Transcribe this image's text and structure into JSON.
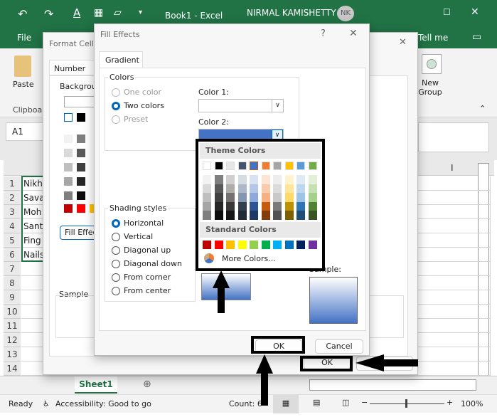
{
  "titlebar": {
    "doc_title": "Book1  -  Excel",
    "user_name": "NIRMAL KAMISHETTY",
    "user_initials": "NK",
    "tab_file": "File",
    "tell_me": "Tell me"
  },
  "ribbon": {
    "paste_label": "Paste",
    "clipboard_label": "Clipboard",
    "new_group_label": "New Group"
  },
  "formula_bar": {
    "name_box": "A1"
  },
  "grid": {
    "column_i": "I",
    "rows": [
      "1",
      "2",
      "3",
      "4",
      "5",
      "6",
      "7",
      "8",
      "9",
      "10",
      "11",
      "12",
      "13",
      "14"
    ],
    "cells": [
      "Nikh",
      "Sava",
      "Moh",
      "Sant",
      "Fing",
      "Nails"
    ]
  },
  "sheet_tabs": {
    "active": "Sheet1"
  },
  "status": {
    "ready": "Ready",
    "accessibility": "Accessibility: Good to go",
    "count": "Count: 6",
    "zoom": "100%"
  },
  "format_cells": {
    "title": "Format Cells",
    "tab_number": "Number",
    "background_label": "Background Color:",
    "fill_effects_button": "Fill Effects...",
    "sample_label": "Sample",
    "ok": "OK"
  },
  "fill_effects": {
    "title": "Fill Effects",
    "help": "?",
    "tab": "Gradient",
    "colors_group": "Colors",
    "one_color": "One color",
    "two_colors": "Two colors",
    "preset": "Preset",
    "color1_label": "Color 1:",
    "color2_label": "Color 2:",
    "shading_group": "Shading styles",
    "shading": [
      "Horizontal",
      "Vertical",
      "Diagonal up",
      "Diagonal down",
      "From corner",
      "From center"
    ],
    "sample_label": "Sample:",
    "ok": "OK",
    "cancel": "Cancel"
  },
  "color_popup": {
    "theme_header": "Theme Colors",
    "standard_header": "Standard Colors",
    "more_colors": "More Colors...",
    "theme": [
      "#ffffff",
      "#000000",
      "#e7e6e6",
      "#44546a",
      "#4472c4",
      "#ed7d31",
      "#a5a5a5",
      "#ffc000",
      "#5b9bd5",
      "#70ad47"
    ],
    "shades": [
      [
        "#f2f2f2",
        "#d9d9d9",
        "#bfbfbf",
        "#a6a6a6",
        "#7f7f7f"
      ],
      [
        "#7f7f7f",
        "#595959",
        "#404040",
        "#262626",
        "#0d0d0d"
      ],
      [
        "#d0cece",
        "#aeabab",
        "#757171",
        "#3a3838",
        "#171616"
      ],
      [
        "#d6dce4",
        "#adb9ca",
        "#8497b0",
        "#333f4f",
        "#222a35"
      ],
      [
        "#d9e2f3",
        "#b4c6e7",
        "#8eaadb",
        "#2f5496",
        "#1f3864"
      ],
      [
        "#fbe5d5",
        "#f7cbac",
        "#f4b183",
        "#c55a11",
        "#843c0b"
      ],
      [
        "#ededed",
        "#dbdbdb",
        "#c9c9c9",
        "#7b7b7b",
        "#525252"
      ],
      [
        "#fff2cc",
        "#ffe699",
        "#ffd966",
        "#bf9000",
        "#7f6000"
      ],
      [
        "#deebf6",
        "#bdd7ee",
        "#9dc3e6",
        "#2e75b5",
        "#1f4e79"
      ],
      [
        "#e2efd9",
        "#c5e0b3",
        "#a8d08d",
        "#538135",
        "#375623"
      ]
    ],
    "standard": [
      "#c00000",
      "#ff0000",
      "#ffc000",
      "#ffff00",
      "#92d050",
      "#00b050",
      "#00b0f0",
      "#0070c0",
      "#002060",
      "#7030a0"
    ]
  }
}
